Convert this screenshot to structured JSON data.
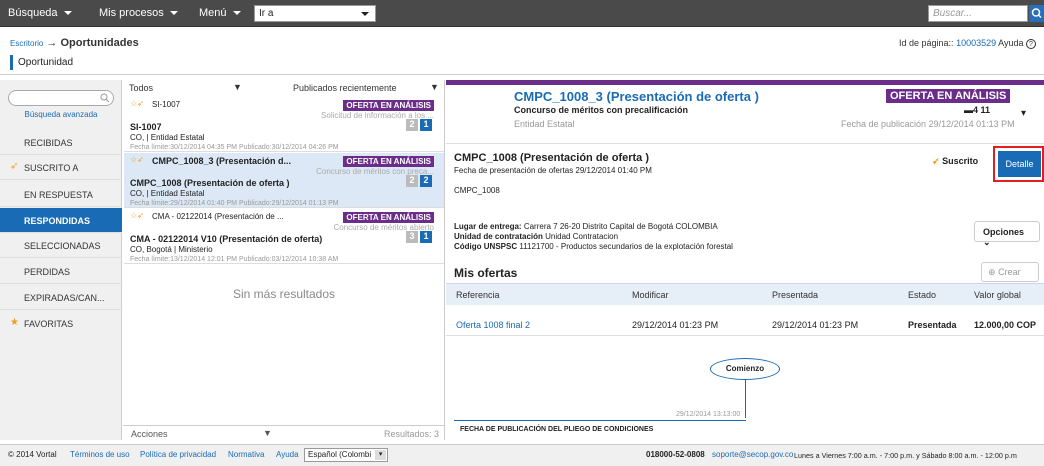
{
  "topbar": {
    "menus": [
      "Búsqueda",
      "Mis procesos",
      "Menú"
    ],
    "ira": "Ir a",
    "search_placeholder": "Buscar..."
  },
  "breadcrumb": {
    "root": "Escritorio",
    "arrow": "→",
    "current": "Oportunidades"
  },
  "page_id": {
    "label": "Id de página::",
    "value": "10003529",
    "help": "Ayuda"
  },
  "section_title": "Oportunidad",
  "sidebar": {
    "advanced_search": "Búsqueda avanzada",
    "items": [
      {
        "label": "RECIBIDAS",
        "icon": ""
      },
      {
        "label": "SUSCRITO A",
        "icon": "pin-icon"
      },
      {
        "label": "EN RESPUESTA",
        "icon": ""
      },
      {
        "label": "RESPONDIDAS",
        "icon": ""
      },
      {
        "label": "SELECCIONADAS",
        "icon": ""
      },
      {
        "label": "PERDIDAS",
        "icon": ""
      },
      {
        "label": "EXPIRADAS/CAN...",
        "icon": ""
      },
      {
        "label": "FAVORITAS",
        "icon": "star-icon"
      }
    ]
  },
  "list": {
    "filter1": "Todos",
    "filter2": "Publicados recientemente",
    "cards": [
      {
        "ref": "SI-1007",
        "badge": "OFERTA EN ANÁLISIS",
        "sub": "Solicitud de información a los ...",
        "title": "SI-1007",
        "entity": "CO, | Entidad Estatal",
        "n1": "2",
        "n2": "1",
        "dates": "Fecha límite:30/12/2014 04:35 PM Publicado:30/12/2014 04:26 PM"
      },
      {
        "ref": "CMPC_1008_3 (Presentación d...",
        "badge": "OFERTA EN ANÁLISIS",
        "sub": "Concurso de méritos con preca...",
        "title": "CMPC_1008 (Presentación de oferta )",
        "entity": "CO, | Entidad Estatal",
        "n1": "2",
        "n2": "2",
        "dates": "Fecha límite:29/12/2014 01:40 PM Publicado:29/12/2014 01:13 PM"
      },
      {
        "ref": "CMA - 02122014 (Presentación de ...",
        "badge": "OFERTA EN ANÁLISIS",
        "sub": "Concurso de méritos abierto",
        "title": "CMA - 02122014 V10 (Presentación de oferta)",
        "entity": "CO, Bogotá | Ministerio",
        "n1": "3",
        "n2": "1",
        "dates": "Fecha límite:13/12/2014 12:01 PM Publicado:03/12/2014 10:38 AM"
      }
    ],
    "no_more": "Sin más resultados",
    "actions": "Acciones",
    "results": "Resultados: 3"
  },
  "detail": {
    "title": "CMPC_1008_3 (Presentación de oferta )",
    "subtitle": "Concurso de méritos con precalificación",
    "entity": "Entidad Estatal",
    "status": "OFERTA EN ANÁLISIS",
    "counts": "4  11",
    "pubdate": "Fecha de publicación 29/12/2014 01:13 PM",
    "proc_title": "CMPC_1008 (Presentación de oferta )",
    "proc_date": "Fecha de presentación de ofertas 29/12/2014 01:40 PM",
    "proc_code": "CMPC_1008",
    "suscrito": "Suscrito",
    "detalle": "Detalle",
    "lugar_label": "Lugar de entrega:",
    "lugar": "Carrera 7 26-20 Distrito Capital de Bogotá COLOMBIA",
    "unidad_label": "Unidad de contratación",
    "unidad": "Unidad Contratacion",
    "unspsc_label": "Código UNSPSC",
    "unspsc": "11121700 - Productos secundarios de la explotación forestal",
    "opciones": "Opciones",
    "mis_ofertas": "Mis ofertas",
    "crear": "Crear",
    "table_headers": [
      "Referencia",
      "Modificar",
      "Presentada",
      "Estado",
      "Valor global"
    ],
    "row": {
      "ref": "Oferta 1008 final 2",
      "mod": "29/12/2014 01:23 PM",
      "pres": "29/12/2014 01:23 PM",
      "estado": "Presentada",
      "valor": "12.000,00 COP"
    },
    "comienzo": "Comienzo",
    "tl_date": "29/12/2014 13:13:00",
    "tl_label": "FECHA DE PUBLICACIÓN DEL PLIEGO DE CONDICIONES"
  },
  "footer": {
    "copy": "© 2014 Vortal",
    "links": [
      "Términos de uso",
      "Política de privacidad",
      "Normativa",
      "Ayuda"
    ],
    "lang": "Español (Colombi",
    "phone": "018000-52-0808",
    "email": "soporte@secop.gov.co",
    "hours": "Lunes a Viernes 7:00 a.m. - 7:00 p.m. y Sábado 8:00 a.m. - 12:00 p.m"
  },
  "colors": {
    "accent": "#1a6bb5",
    "badge": "#6a2d8a",
    "highlight": "#e02020"
  }
}
